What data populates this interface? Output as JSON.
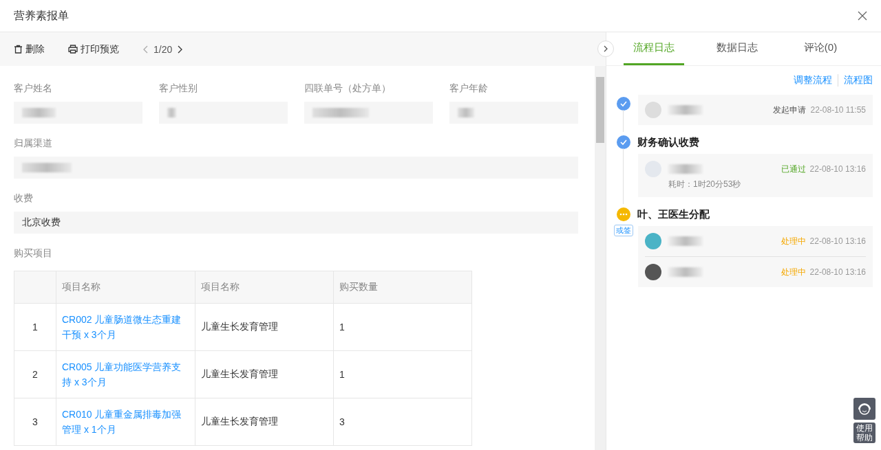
{
  "window": {
    "title": "营养素报单"
  },
  "toolbar": {
    "delete": "删除",
    "print": "打印预览",
    "pager": "1/20"
  },
  "fields_row": [
    {
      "label": "客户姓名"
    },
    {
      "label": "客户性别"
    },
    {
      "label": "四联单号（处方单）"
    },
    {
      "label": "客户年龄"
    }
  ],
  "channel": {
    "label": "归属渠道"
  },
  "fee": {
    "label": "收费",
    "value": "北京收费"
  },
  "items": {
    "label": "购买项目",
    "columns": [
      "",
      "项目名称",
      "项目名称",
      "购买数量"
    ],
    "rows": [
      {
        "index": "1",
        "name": "CR002  儿童肠道微生态重建干预 x 3个月",
        "category": "儿童生长发育管理",
        "qty": "1"
      },
      {
        "index": "2",
        "name": "CR005  儿童功能医学营养支持 x 3个月",
        "category": "儿童生长发育管理",
        "qty": "1"
      },
      {
        "index": "3",
        "name": "CR010  儿童重金属排毒加强管理 x 1个月",
        "category": "儿童生长发育管理",
        "qty": "3"
      }
    ]
  },
  "tabs": [
    {
      "label": "流程日志",
      "selected": true
    },
    {
      "label": "数据日志",
      "selected": false
    },
    {
      "label": "评论(0)",
      "selected": false
    }
  ],
  "actions": [
    "调整流程",
    "流程图"
  ],
  "steps": [
    {
      "kind": "done",
      "records": [
        {
          "kind": "started",
          "status": "发起申请",
          "time": "22-08-10 11:55"
        }
      ]
    },
    {
      "kind": "done",
      "title": "财务确认收费",
      "records": [
        {
          "kind": "approved",
          "status": "已通过",
          "time": "22-08-10 13:16",
          "duration": "耗时：1时20分53秒"
        }
      ]
    },
    {
      "kind": "pending",
      "title": "叶、王医生分配",
      "tag": "或签",
      "records": [
        {
          "kind": "processing",
          "status": "处理中",
          "time": "22-08-10 13:16"
        },
        {
          "kind": "processing",
          "status": "处理中",
          "time": "22-08-10 13:16"
        }
      ]
    }
  ],
  "help": {
    "label": "使用帮助"
  }
}
